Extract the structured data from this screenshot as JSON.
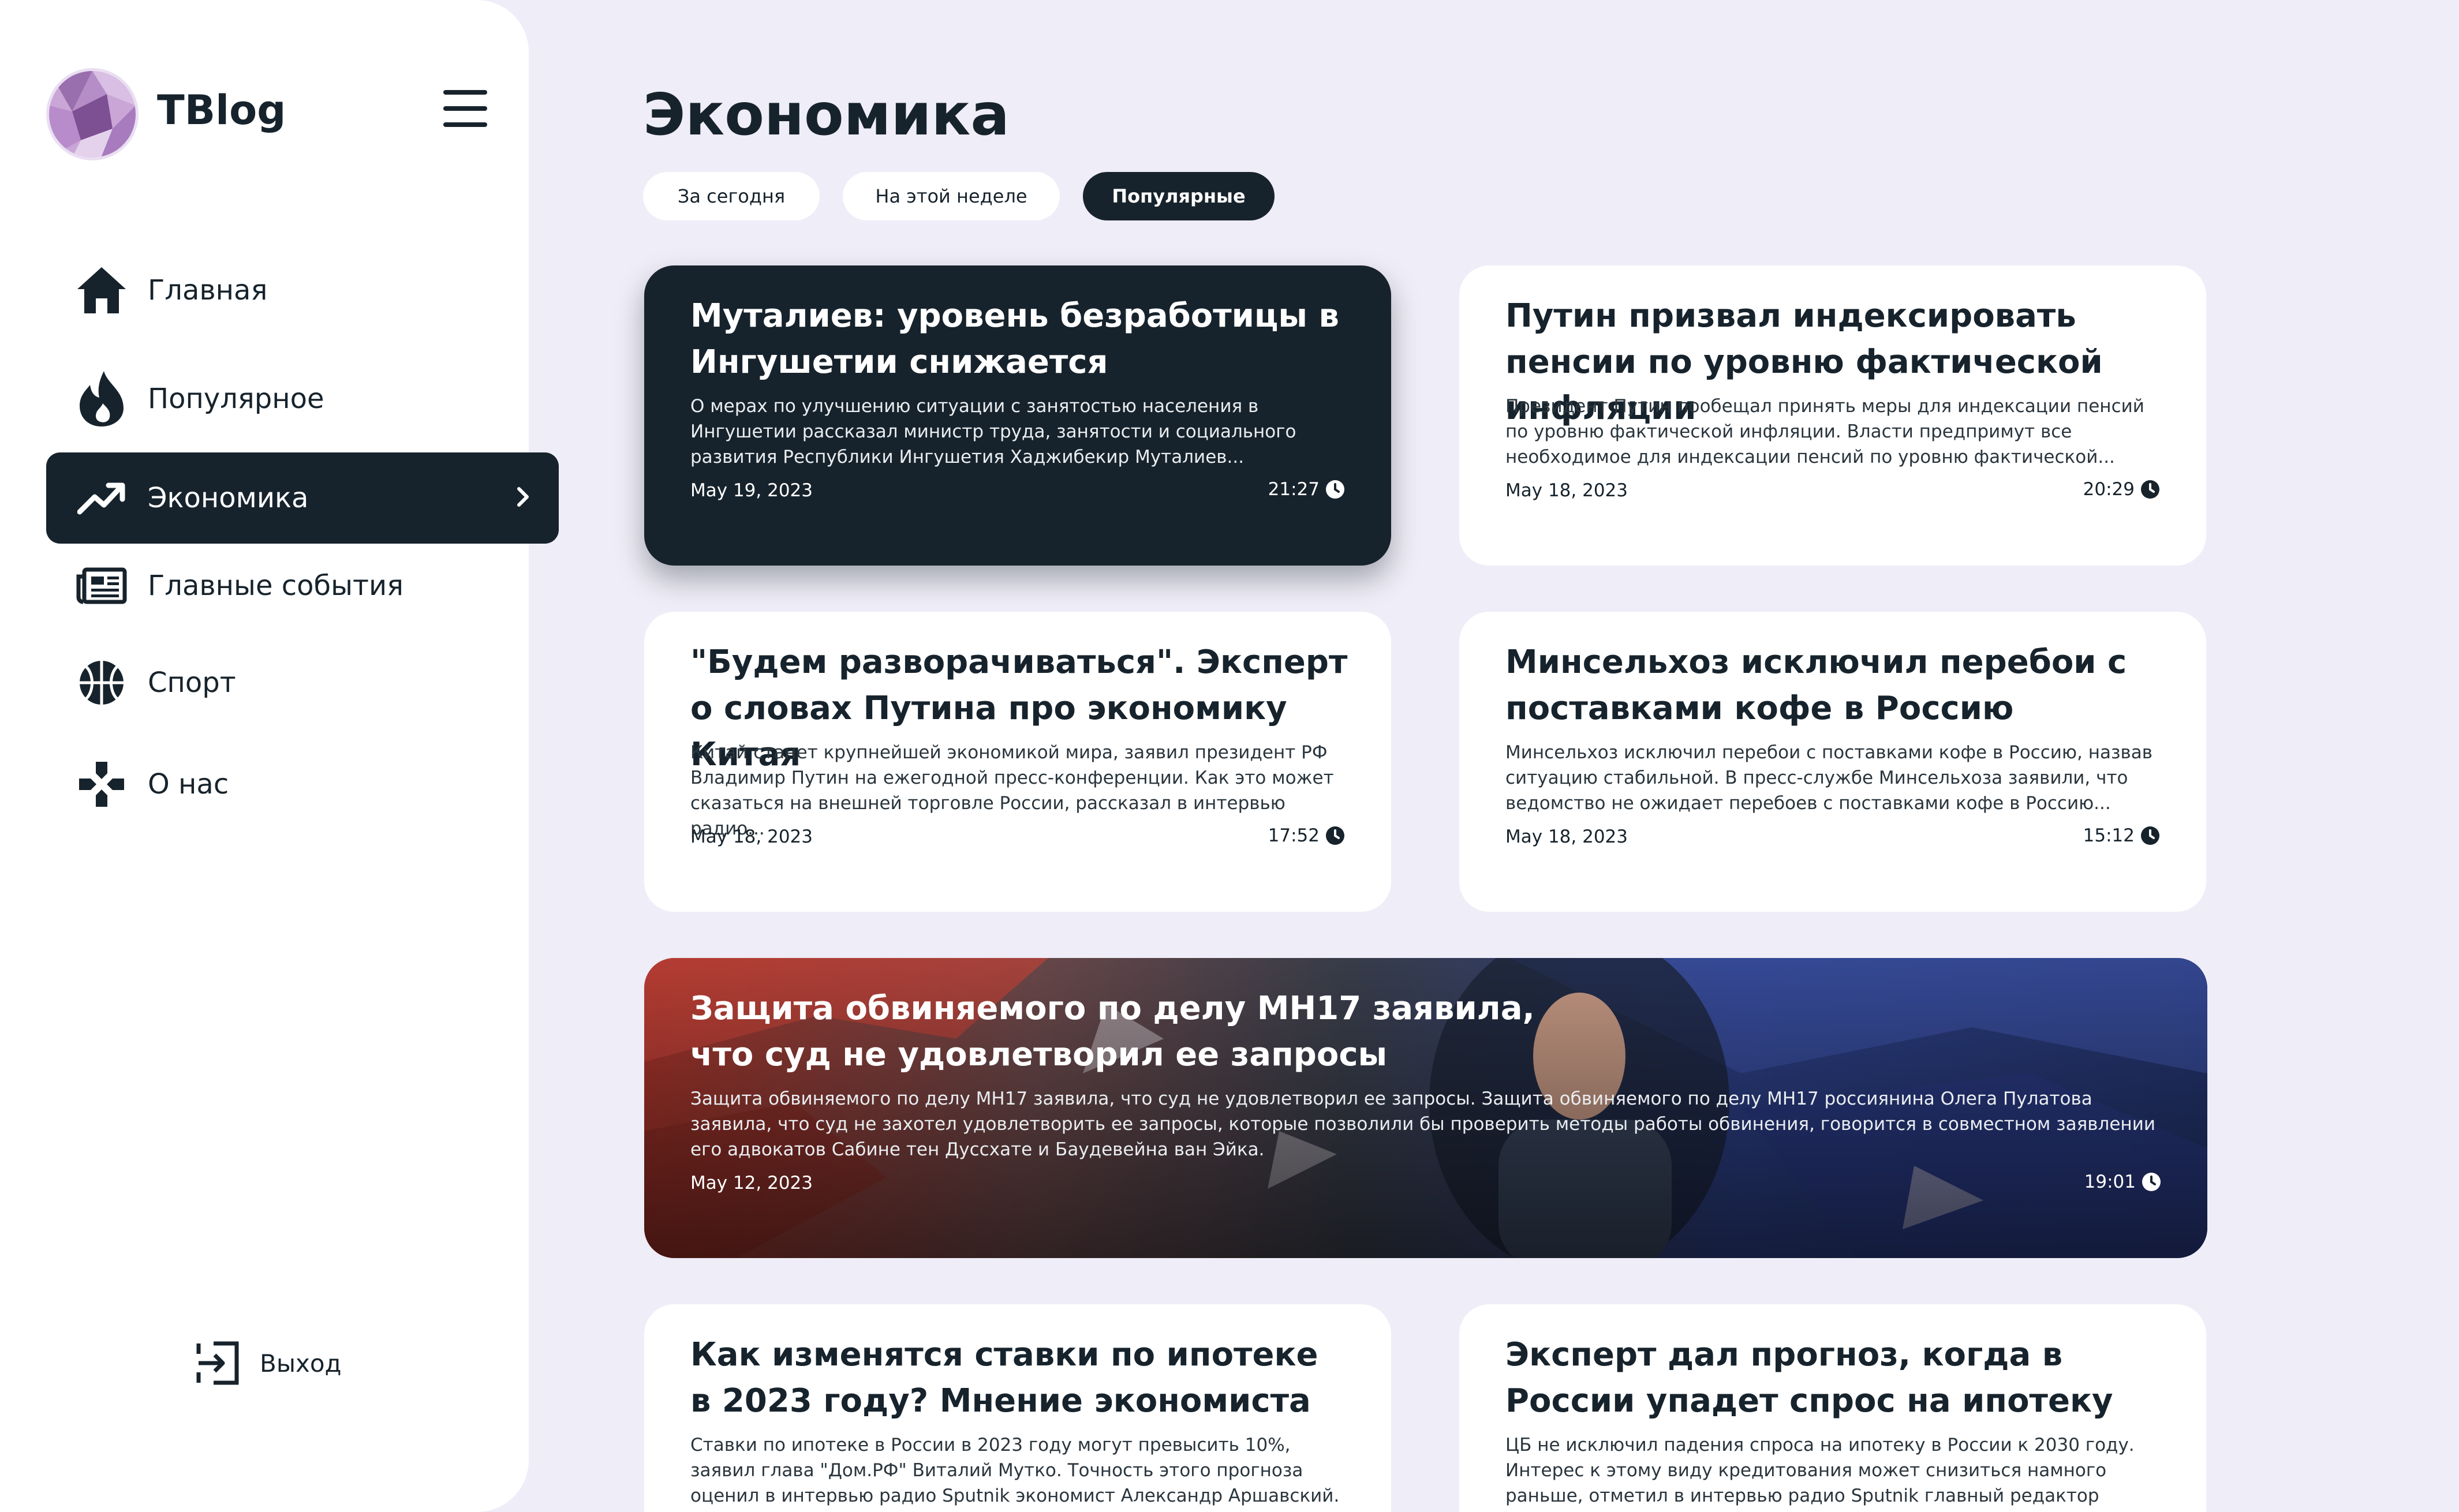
{
  "app": {
    "brand": "TBlog"
  },
  "sidebar": {
    "items": [
      {
        "label": "Главная",
        "icon": "home-icon"
      },
      {
        "label": "Популярное",
        "icon": "flame-icon"
      },
      {
        "label": "Экономика",
        "icon": "trending-up-icon",
        "active": true
      },
      {
        "label": "Главные события",
        "icon": "newspaper-icon"
      },
      {
        "label": "Спорт",
        "icon": "basketball-icon"
      },
      {
        "label": "О нас",
        "icon": "gamepad-icon"
      }
    ],
    "logout_label": "Выход"
  },
  "main": {
    "title": "Экономика",
    "filters": [
      {
        "label": "За сегодня"
      },
      {
        "label": "На этой неделе"
      },
      {
        "label": "Популярные",
        "active": true
      }
    ],
    "articles": [
      {
        "title": "Муталиев: уровень безработицы в Ингушетии снижается",
        "excerpt": "О мерах по улучшению ситуации с занятостью населения в Ингушетии рассказал министр труда, занятости и социального развития Республики Ингушетия Хаджибекир Муталиев...",
        "date": "May 19, 2023",
        "time": "21:27"
      },
      {
        "title": "Путин призвал индексировать пенсии по уровню фактической инфляции",
        "excerpt": "Президент Путин пообещал принять меры для индексации пенсий по уровню фактической инфляции. Власти предпримут все необходимое для индексации пенсий по уровню фактической...",
        "date": "May 18, 2023",
        "time": "20:29"
      },
      {
        "title": "\"Будем разворачиваться\". Эксперт о словах Путина про экономику Китая",
        "excerpt": "Китай станет крупнейшей экономикой мира, заявил президент РФ Владимир Путин на ежегодной пресс-конференции. Как это может сказаться на внешней торговле России, рассказал в интервью радио...",
        "date": "May 18, 2023",
        "time": "17:52"
      },
      {
        "title": "Минсельхоз исключил перебои с поставками кофе в Россию",
        "excerpt": "Минсельхоз исключил перебои с поставками кофе в Россию, назвав ситуацию стабильной. В пресс-службе Минсельхоза заявили, что ведомство не ожидает перебоев с поставками кофе в Россию...",
        "date": "May 18, 2023",
        "time": "15:12"
      },
      {
        "title": "Защита обвиняемого по делу MH17 заявила, что суд не удовлетворил ее запросы",
        "excerpt": "Защита обвиняемого по делу MH17 заявила, что суд не удовлетворил ее запросы. Защита обвиняемого по делу MH17 россиянина Олега Пулатова заявила, что суд не захотел удовлетворить ее запросы, которые позволили бы проверить методы работы обвинения, говорится в совместном заявлении его адвокатов Сабине тен Дуссхате и Баудевейна ван Эйка.",
        "date": "May 12, 2023",
        "time": "19:01"
      },
      {
        "title": "Как изменятся ставки по ипотеке в 2023 году? Мнение экономиста",
        "excerpt": "Ставки по ипотеке в России в 2023 году могут превысить 10%, заявил глава \"Дом.РФ\" Виталий Мутко. Точность этого прогноза оценил в интервью радио Sputnik экономист Александр Аршавский.",
        "date": "",
        "time": ""
      },
      {
        "title": "Эксперт дал прогноз, когда в России упадет спрос на ипотеку",
        "excerpt": "ЦБ не исключил падения спроса на ипотеку в России к 2030 году. Интерес к этому виду кредитования может снизиться намного раньше, отметил в интервью радио Sputnik главный редактор журнала...",
        "date": "",
        "time": ""
      }
    ]
  },
  "colors": {
    "accent": "#17232c",
    "background": "#efedf7",
    "card": "#ffffff"
  }
}
